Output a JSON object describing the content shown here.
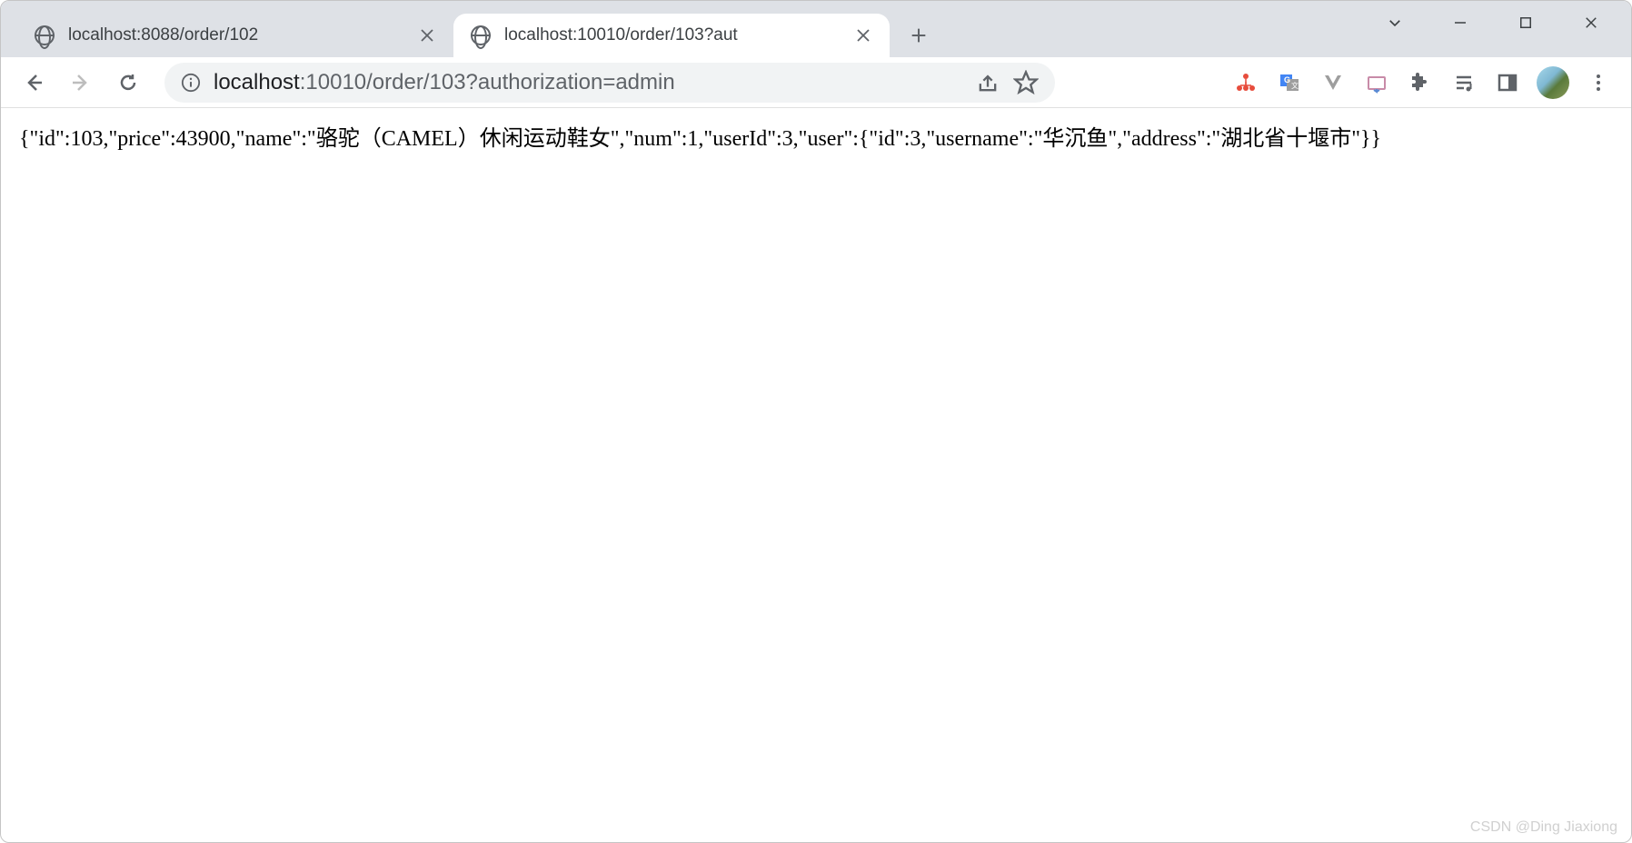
{
  "tabs": [
    {
      "title": "localhost:8088/order/102",
      "active": false
    },
    {
      "title": "localhost:10010/order/103?aut",
      "active": true
    }
  ],
  "address": {
    "host": "localhost",
    "rest": ":10010/order/103?authorization=admin",
    "full": "localhost:10010/order/103?authorization=admin"
  },
  "page_body": "{\"id\":103,\"price\":43900,\"name\":\"骆驼（CAMEL）休闲运动鞋女\",\"num\":1,\"userId\":3,\"user\":{\"id\":3,\"username\":\"华沉鱼\",\"address\":\"湖北省十堰市\"}}",
  "watermark": "CSDN @Ding Jiaxiong",
  "icons": {
    "back": "back-icon",
    "forward": "forward-icon",
    "reload": "reload-icon",
    "info": "info-icon",
    "share": "share-icon",
    "star": "star-icon",
    "ext_red": "sitemap-icon",
    "ext_translate": "google-translate-icon",
    "ext_vue": "vue-icon",
    "ext_folder": "folder-icon",
    "ext_puzzle": "puzzle-icon",
    "ext_music": "music-list-icon",
    "ext_panel": "side-panel-icon",
    "menu": "menu-icon",
    "tab_chevron": "chevron-down-icon",
    "minimize": "minimize-icon",
    "maximize": "maximize-icon",
    "close_window": "close-icon",
    "close_tab": "close-icon",
    "newtab": "plus-icon",
    "globe": "globe-icon"
  }
}
